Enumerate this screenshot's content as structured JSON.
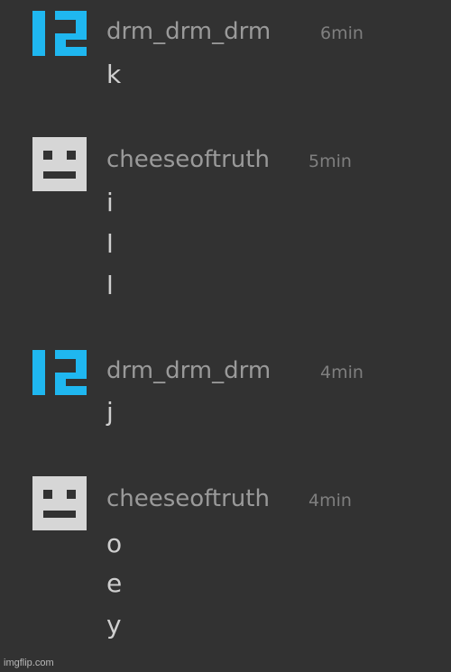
{
  "messages": [
    {
      "username": "drm_drm_drm",
      "timestamp": "6min",
      "avatar": "blue-block-avatar",
      "lines": [
        "k"
      ]
    },
    {
      "username": "cheeseoftruth",
      "timestamp": "5min",
      "avatar": "gray-face-avatar",
      "lines": [
        "i",
        "l",
        "l"
      ]
    },
    {
      "username": "drm_drm_drm",
      "timestamp": "4min",
      "avatar": "blue-block-avatar",
      "lines": [
        "j"
      ]
    },
    {
      "username": "cheeseoftruth",
      "timestamp": "4min",
      "avatar": "gray-face-avatar",
      "lines": [
        "o",
        "e",
        "y"
      ]
    }
  ],
  "watermark": "imgflip.com",
  "colors": {
    "background": "#323232",
    "username": "#9a9a9a",
    "timestamp": "#7f7f7f",
    "message_text": "#cfcfcf",
    "blue_avatar": "#1fb7f0",
    "gray_avatar": "#d6d6d6"
  }
}
